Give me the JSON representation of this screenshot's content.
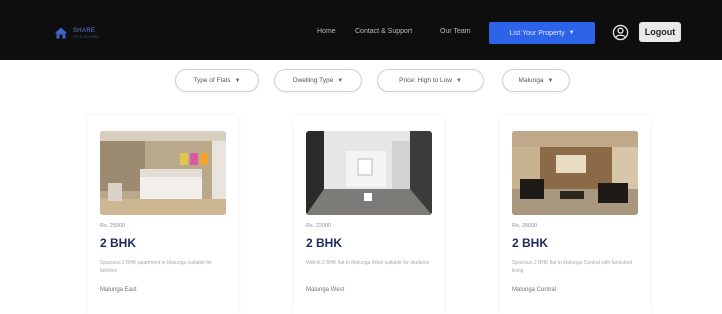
{
  "brand": {
    "name": "SHARE",
    "tagline": "PG & ROOMS",
    "accent": "#5b7fd9"
  },
  "nav": {
    "links": [
      {
        "label": "Home"
      },
      {
        "label": "Contact & Support"
      },
      {
        "label": "Our Team"
      }
    ],
    "list_property_label": "List Your Property",
    "list_property_color": "#2c63e8",
    "user_icon": "user-circle-icon",
    "logout_label": "Logout"
  },
  "filters": [
    {
      "label": "Type of Flats"
    },
    {
      "label": "Dwelling Type"
    },
    {
      "label": "Price: High to Low"
    },
    {
      "label": "Malunga"
    }
  ],
  "listings": [
    {
      "price": "Rs. 25000",
      "title": "2 BHK",
      "description": "Spacious 2 BHK apartment in Malunga suitable for families",
      "location": "Malunga East"
    },
    {
      "price": "Rs. 22000",
      "title": "2 BHK",
      "description": "Well lit 2 BHK flat in Malunga West suitable for students",
      "location": "Malunga West"
    },
    {
      "price": "Rs. 28000",
      "title": "2 BHK",
      "description": "Spacious 2 BHK flat in Malunga Central with furnished living",
      "location": "Malunga Central"
    }
  ]
}
